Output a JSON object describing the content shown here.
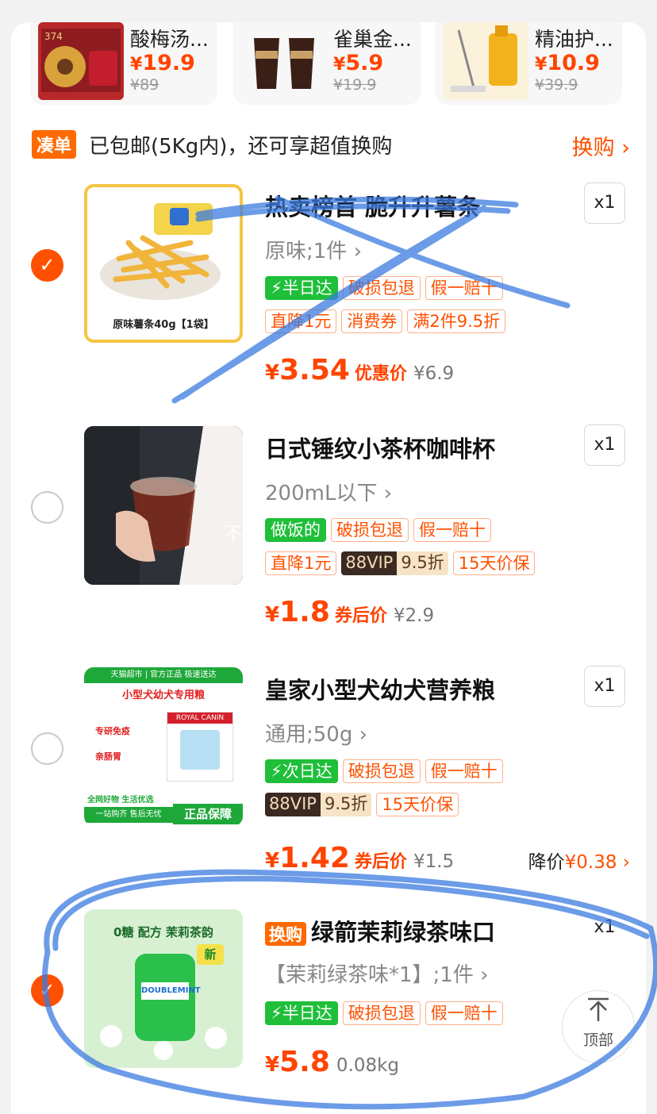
{
  "recommendations": [
    {
      "name": "酸梅汤...",
      "price_symbol": "¥",
      "price": "19.9",
      "original": "¥89"
    },
    {
      "name": "雀巢金...",
      "price_symbol": "¥",
      "price": "5.9",
      "original": "¥19.9"
    },
    {
      "name": "精油护...",
      "price_symbol": "¥",
      "price": "10.9",
      "original": "¥39.9"
    }
  ],
  "bundle": {
    "tag": "凑单",
    "text": "已包邮(5Kg内)，还可享超值换购",
    "more": "换购 ›"
  },
  "items": [
    {
      "checked": true,
      "title": "热卖榜首 脆升升薯条",
      "spec": "原味;1件 ›",
      "qty": "x1",
      "image_caption": "原味薯条40g【1袋】",
      "tags_row1": [
        "⚡半日达",
        "破损包退",
        "假一赔十"
      ],
      "tags_row2": [
        "直降1元",
        "消费券",
        "满2件9.5折"
      ],
      "price_symbol": "¥",
      "price": "3.54",
      "price_label": "优惠价",
      "original": "¥6.9"
    },
    {
      "checked": false,
      "title": "日式锤纹小茶杯咖啡杯",
      "spec": "200mL以下 ›",
      "qty": "x1",
      "watermark": "不爱做饭的",
      "tags_row1": [
        "做饭的",
        "破损包退",
        "假一赔十"
      ],
      "tags_row2": [
        "直降1元"
      ],
      "vip": {
        "left": "88VIP",
        "right": "9.5折"
      },
      "tags_row2_after": [
        "15天价保"
      ],
      "price_symbol": "¥",
      "price": "1.8",
      "price_label": "券后价",
      "original": "¥2.9"
    },
    {
      "checked": false,
      "title": "皇家小型犬幼犬营养粮",
      "spec": "通用;50g ›",
      "qty": "x1",
      "image_text": {
        "top": "天猫超市 | 官方正品 极速送达",
        "banner": "小型犬幼犬专用粮",
        "f1": "专研免疫",
        "f2": "亲肠胃",
        "brand": "ROYAL CANIN",
        "b1": "全网好物 生活优选",
        "b2": "一站购齐 售后无忧",
        "seal": "正品保障"
      },
      "tags_row1": [
        "⚡次日达",
        "破损包退",
        "假一赔十"
      ],
      "vip": {
        "left": "88VIP",
        "right": "9.5折"
      },
      "tags_row2_after": [
        "15天价保"
      ],
      "price_symbol": "¥",
      "price": "1.42",
      "price_label": "券后价",
      "original": "¥1.5",
      "drop": {
        "label": "降价",
        "value": "¥0.38 ›"
      }
    },
    {
      "checked": true,
      "swap_tag": "换购",
      "title": "绿箭茉莉绿茶味口",
      "spec": "【茉莉绿茶味*1】;1件 ›",
      "qty": "x1",
      "image_text": {
        "headline": "0糖 配方 茉莉茶韵",
        "brand": "DOUBLEMINT",
        "new": "新"
      },
      "tags_row1": [
        "⚡半日达",
        "破损包退",
        "假一赔十"
      ],
      "price_symbol": "¥",
      "price": "5.8",
      "weight": "0.08kg"
    }
  ],
  "back_to_top": {
    "arrow": "⊼",
    "label": "顶部"
  },
  "colors": {
    "accent": "#ff5000",
    "tag_green": "#1fbf3a",
    "doodle_blue": "#3b7be0"
  }
}
